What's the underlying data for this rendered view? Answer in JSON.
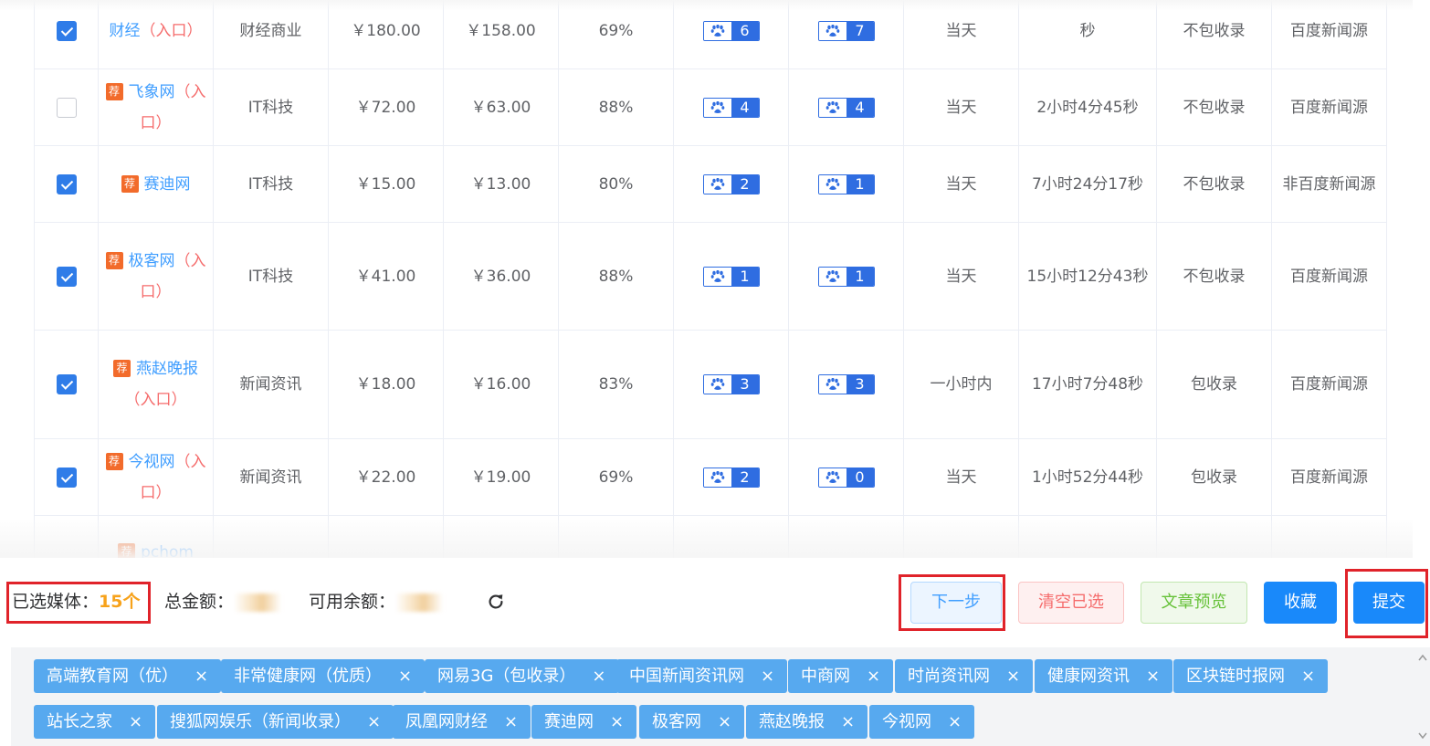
{
  "table": {
    "rows": [
      {
        "checked": true,
        "rec": "",
        "name": "财经",
        "link": "（入口）",
        "category": "财经商业",
        "price": "￥180.00",
        "vip_price": "￥158.00",
        "rate": "69%",
        "baidu_pc": "6",
        "baidu_mobile": "7",
        "speed": "当天",
        "avg_time": "秒",
        "include": "不包收录",
        "source": "百度新闻源"
      },
      {
        "checked": false,
        "rec": "荐",
        "name": "飞象网",
        "link": "（入口）",
        "category": "IT科技",
        "price": "￥72.00",
        "vip_price": "￥63.00",
        "rate": "88%",
        "baidu_pc": "4",
        "baidu_mobile": "4",
        "speed": "当天",
        "avg_time": "2小时4分45秒",
        "include": "不包收录",
        "source": "百度新闻源"
      },
      {
        "checked": true,
        "rec": "荐",
        "name": "赛迪网",
        "link": "",
        "category": "IT科技",
        "price": "￥15.00",
        "vip_price": "￥13.00",
        "rate": "80%",
        "baidu_pc": "2",
        "baidu_mobile": "1",
        "speed": "当天",
        "avg_time": "7小时24分17秒",
        "include": "不包收录",
        "source": "非百度新闻源"
      },
      {
        "checked": true,
        "rec": "荐",
        "name": "极客网",
        "link": "（入口）",
        "category": "IT科技",
        "price": "￥41.00",
        "vip_price": "￥36.00",
        "rate": "88%",
        "baidu_pc": "1",
        "baidu_mobile": "1",
        "speed": "当天",
        "avg_time": "15小时12分43秒",
        "include": "不包收录",
        "source": "百度新闻源"
      },
      {
        "checked": true,
        "rec": "荐",
        "name": "燕赵晚报",
        "link": "（入口）",
        "category": "新闻资讯",
        "price": "￥18.00",
        "vip_price": "￥16.00",
        "rate": "83%",
        "baidu_pc": "3",
        "baidu_mobile": "3",
        "speed": "一小时内",
        "avg_time": "17小时7分48秒",
        "include": "包收录",
        "source": "百度新闻源"
      },
      {
        "checked": true,
        "rec": "荐",
        "name": "今视网",
        "link": "（入口）",
        "category": "新闻资讯",
        "price": "￥22.00",
        "vip_price": "￥19.00",
        "rate": "69%",
        "baidu_pc": "2",
        "baidu_mobile": "0",
        "speed": "当天",
        "avg_time": "1小时52分44秒",
        "include": "包收录",
        "source": "百度新闻源"
      },
      {
        "checked": null,
        "rec": "荐",
        "name": "pchom",
        "link": "",
        "category": "",
        "price": "",
        "vip_price": "",
        "rate": "",
        "baidu_pc": "",
        "baidu_mobile": "",
        "speed": "",
        "avg_time": "",
        "include": "",
        "source": ""
      }
    ]
  },
  "footer": {
    "selected_label": "已选媒体：",
    "selected_count": "15个",
    "total_label": "总金额：",
    "balance_label": "可用余额：",
    "buttons": {
      "next": "下一步",
      "clear": "清空已选",
      "preview": "文章预览",
      "favorite": "收藏",
      "submit": "提交"
    }
  },
  "tags": [
    "高端教育网（优）",
    "非常健康网（优质）",
    "网易3G（包收录）",
    "中国新闻资讯网",
    "中商网",
    "时尚资讯网",
    "健康网资讯",
    "区块链时报网",
    "站长之家",
    "搜狐网娱乐（新闻收录）",
    "凤凰网财经",
    "赛迪网",
    "极客网",
    "燕赵晚报",
    "今视网"
  ],
  "tag_close_glyph": "×",
  "colors": {
    "accent_blue": "#409eff",
    "checkbox_blue": "#2f7ce8",
    "baidu_blue": "#2f6de1",
    "recommend_orange": "#f26b2b",
    "entry_red": "#f56c6c",
    "count_orange": "#f7a21a",
    "highlight_red": "#e0232a",
    "tag_blue": "#57a9ef"
  },
  "icons": {
    "recommend": "recommend-badge",
    "baidu": "baidu-paw-icon",
    "refresh": "refresh-icon",
    "tag_close": "close-icon"
  }
}
